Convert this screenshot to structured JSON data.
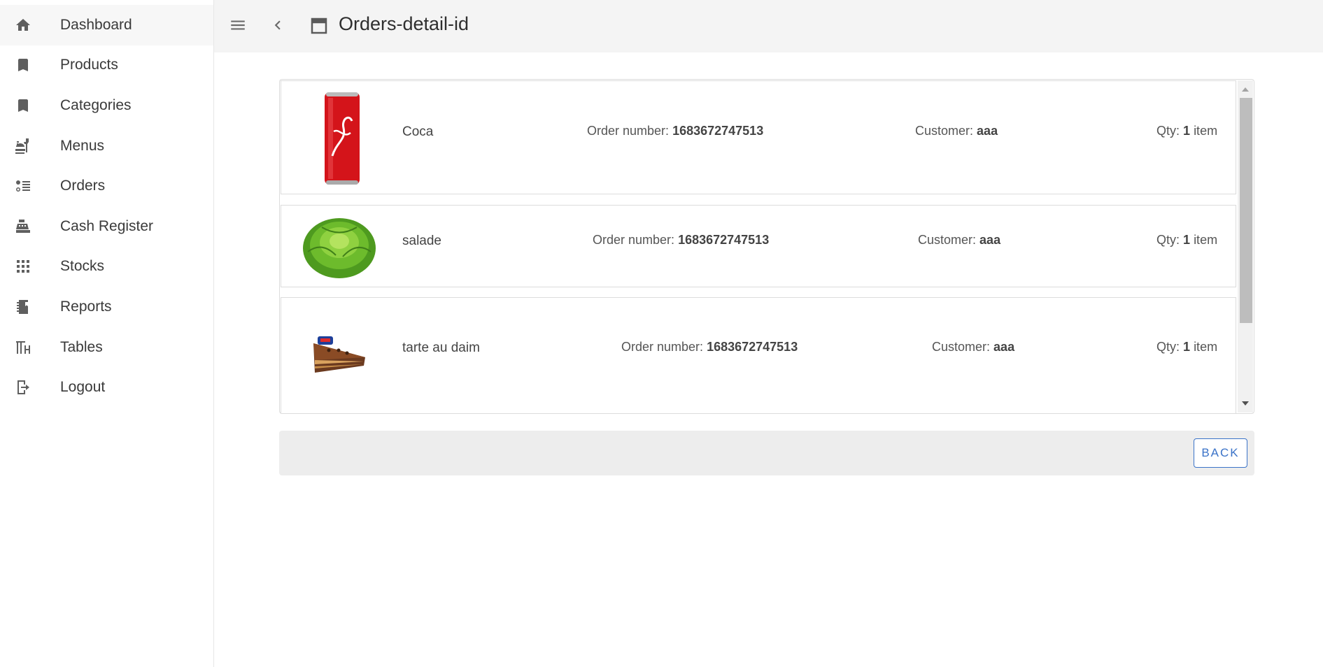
{
  "sidebar": {
    "items": [
      {
        "label": "Dashboard",
        "icon": "home-icon"
      },
      {
        "label": "Products",
        "icon": "bookmark-icon"
      },
      {
        "label": "Categories",
        "icon": "bookmark-icon"
      },
      {
        "label": "Menus",
        "icon": "food-icon"
      },
      {
        "label": "Orders",
        "icon": "list-icon"
      },
      {
        "label": "Cash Register",
        "icon": "cash-register-icon"
      },
      {
        "label": "Stocks",
        "icon": "grid-icon"
      },
      {
        "label": "Reports",
        "icon": "notebook-icon"
      },
      {
        "label": "Tables",
        "icon": "table-furniture-icon"
      },
      {
        "label": "Logout",
        "icon": "logout-icon"
      }
    ]
  },
  "header": {
    "title": "Orders-detail-id"
  },
  "order_items": [
    {
      "name": "Coca",
      "order_number_label": "Order number:",
      "order_number": "1683672747513",
      "customer_label": "Customer:",
      "customer": "aaa",
      "qty_label": "Qty:",
      "qty": "1",
      "qty_unit": "item"
    },
    {
      "name": "salade",
      "order_number_label": "Order number:",
      "order_number": "1683672747513",
      "customer_label": "Customer:",
      "customer": "aaa",
      "qty_label": "Qty:",
      "qty": "1",
      "qty_unit": "item"
    },
    {
      "name": "tarte au daim",
      "order_number_label": "Order number:",
      "order_number": "1683672747513",
      "customer_label": "Customer:",
      "customer": "aaa",
      "qty_label": "Qty:",
      "qty": "1",
      "qty_unit": "item"
    }
  ],
  "footer": {
    "back_label": "BACK"
  },
  "colors": {
    "accent": "#3b73c8",
    "header_bg": "#f4f4f4",
    "icon_gray": "#5f5f5f"
  }
}
